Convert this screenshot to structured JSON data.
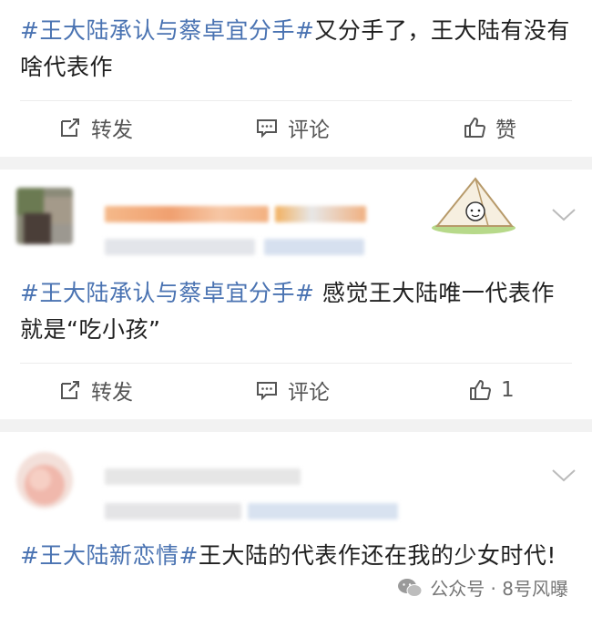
{
  "posts": [
    {
      "tag": "#王大陆承认与蔡卓宜分手#",
      "text": "又分手了，王大陆有没有啥代表作",
      "actions": {
        "repost": "转发",
        "comment": "评论",
        "like": "赞"
      }
    },
    {
      "tag": "#王大陆承认与蔡卓宜分手#",
      "text": " 感觉王大陆唯一代表作就是“吃小孩”",
      "actions": {
        "repost": "转发",
        "comment": "评论",
        "like": "1"
      }
    },
    {
      "tag": "#王大陆新恋情#",
      "text": "王大陆的代表作还在我的少女时代!"
    }
  ],
  "watermark": {
    "text": "公众号 · 8号风曝",
    "icon": "wechat-icon"
  },
  "colors": {
    "tag": "#4a73b2",
    "gap": "#f2f2f2",
    "action_text": "#555555"
  }
}
